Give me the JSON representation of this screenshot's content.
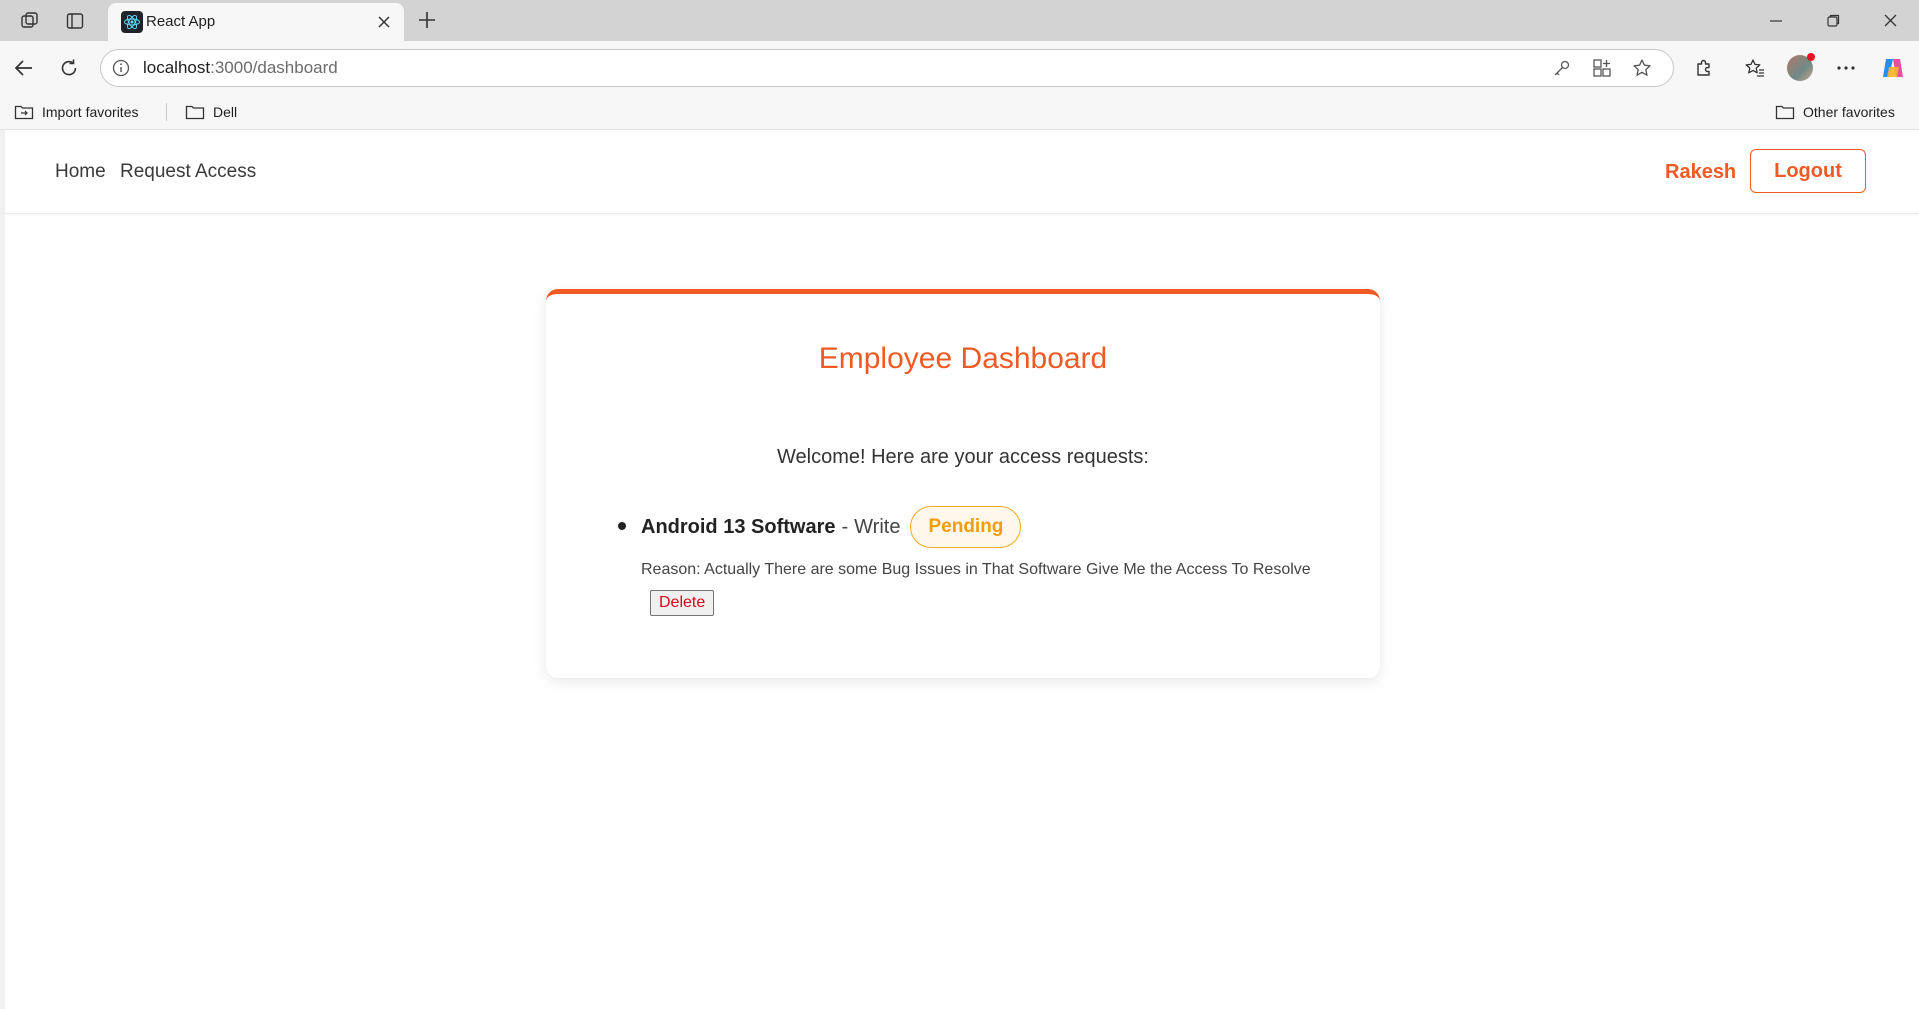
{
  "browser": {
    "tab_title": "React App",
    "url_host": "localhost",
    "url_path": ":3000/dashboard",
    "bookmarks": [
      {
        "label": "Import favorites"
      },
      {
        "label": "Dell"
      }
    ],
    "other_favorites": "Other favorites"
  },
  "nav": {
    "links": [
      {
        "label": "Home"
      },
      {
        "label": "Request Access"
      }
    ],
    "user_name": "Rakesh",
    "logout_label": "Logout"
  },
  "dashboard": {
    "title": "Employee Dashboard",
    "welcome": "Welcome! Here are your access requests:",
    "requests": [
      {
        "software": "Android 13 Software",
        "separator": "-",
        "access": "Write",
        "status": "Pending",
        "reason_label": "Reason:",
        "reason": "Actually There are some Bug Issues in That Software Give Me the Access To Resolve",
        "delete_label": "Delete"
      }
    ]
  },
  "colors": {
    "accent": "#f15a24",
    "pending": "#f39c12"
  }
}
